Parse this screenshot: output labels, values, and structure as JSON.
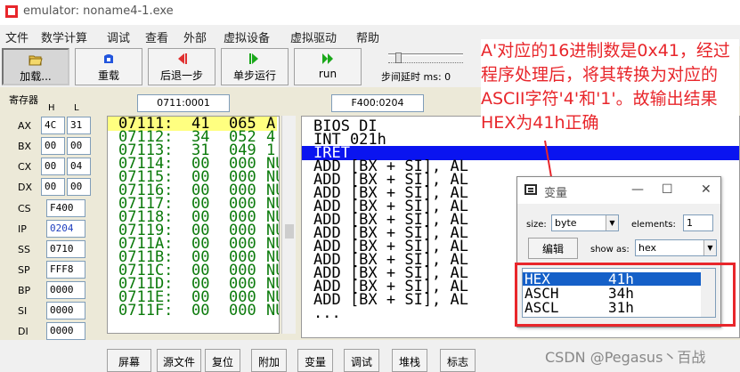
{
  "window": {
    "title": "emulator: noname4-1.exe"
  },
  "menu": [
    "文件",
    "数学计算",
    "调试",
    "查看",
    "外部",
    "虚拟设备",
    "虚拟驱动",
    "帮助"
  ],
  "toolbar": {
    "load": "加载...",
    "reload": "重载",
    "step_back": "后退一步",
    "single_step": "单步运行",
    "run": "run",
    "delay_label": "步间延时 ms: 0"
  },
  "registers": {
    "title": "寄存器",
    "h_label": "H",
    "l_label": "L",
    "general": [
      {
        "name": "AX",
        "h": "4C",
        "l": "31"
      },
      {
        "name": "BX",
        "h": "00",
        "l": "00"
      },
      {
        "name": "CX",
        "h": "00",
        "l": "04"
      },
      {
        "name": "DX",
        "h": "00",
        "l": "00"
      }
    ],
    "segment": [
      {
        "name": "CS",
        "value": "F400"
      },
      {
        "name": "IP",
        "value": "0204"
      },
      {
        "name": "SS",
        "value": "0710"
      },
      {
        "name": "SP",
        "value": "FFF8"
      },
      {
        "name": "BP",
        "value": "0000"
      },
      {
        "name": "SI",
        "value": "0000"
      },
      {
        "name": "DI",
        "value": "0000"
      },
      {
        "name": "DS",
        "value": "0710"
      },
      {
        "name": "ES",
        "value": "0700"
      }
    ]
  },
  "address": {
    "memory": "0711:0001",
    "code": "F400:0204"
  },
  "memory_rows": [
    {
      "addr": "07111:",
      "hex": "41",
      "dec": "065",
      "ch": "A"
    },
    {
      "addr": "07112:",
      "hex": "34",
      "dec": "052",
      "ch": "4"
    },
    {
      "addr": "07113:",
      "hex": "31",
      "dec": "049",
      "ch": "1"
    },
    {
      "addr": "07114:",
      "hex": "00",
      "dec": "000",
      "ch": "NU"
    },
    {
      "addr": "07115:",
      "hex": "00",
      "dec": "000",
      "ch": "NU"
    },
    {
      "addr": "07116:",
      "hex": "00",
      "dec": "000",
      "ch": "NU"
    },
    {
      "addr": "07117:",
      "hex": "00",
      "dec": "000",
      "ch": "NU"
    },
    {
      "addr": "07118:",
      "hex": "00",
      "dec": "000",
      "ch": "NU"
    },
    {
      "addr": "07119:",
      "hex": "00",
      "dec": "000",
      "ch": "NU"
    },
    {
      "addr": "0711A:",
      "hex": "00",
      "dec": "000",
      "ch": "NU"
    },
    {
      "addr": "0711B:",
      "hex": "00",
      "dec": "000",
      "ch": "NU"
    },
    {
      "addr": "0711C:",
      "hex": "00",
      "dec": "000",
      "ch": "NU"
    },
    {
      "addr": "0711D:",
      "hex": "00",
      "dec": "000",
      "ch": "NU"
    },
    {
      "addr": "0711E:",
      "hex": "00",
      "dec": "000",
      "ch": "NU"
    },
    {
      "addr": "0711F:",
      "hex": "00",
      "dec": "000",
      "ch": "NU"
    }
  ],
  "disasm_rows": [
    "BIOS DI",
    "INT 021h",
    "IRET",
    "ADD [BX + SI], AL",
    "ADD [BX + SI], AL",
    "ADD [BX + SI], AL",
    "ADD [BX + SI], AL",
    "ADD [BX + SI], AL",
    "ADD [BX + SI], AL",
    "ADD [BX + SI], AL",
    "ADD [BX + SI], AL",
    "ADD [BX + SI], AL",
    "ADD [BX + SI], AL",
    "ADD [BX + SI], AL",
    "..."
  ],
  "disasm_selected": 2,
  "annotation": "A'对应的16进制数是0x41，经过程序处理后，将其转换为对应的ASCII字符'4'和'1'。故输出结果HEX为41h正确",
  "variables": {
    "title": "变量",
    "size_label": "size:",
    "size_value": "byte",
    "elements_label": "elements:",
    "elements_value": "1",
    "edit_button": "编辑",
    "show_as_label": "show as:",
    "show_as_value": "hex",
    "rows": [
      {
        "name": "HEX",
        "value": "41h"
      },
      {
        "name": "ASCH",
        "value": "34h"
      },
      {
        "name": "ASCL",
        "value": "31h"
      }
    ]
  },
  "bottom_tabs": [
    "屏幕",
    "源文件",
    "复位",
    "附加",
    "变量",
    "调试",
    "堆栈",
    "标志"
  ],
  "watermark": "CSDN @Pegasus丶百战",
  "colors": {
    "accent_red": "#e8262b",
    "selection_blue": "#0a14f0",
    "memory_green": "#0b7a0b",
    "highlight_yellow": "#ffff80"
  }
}
